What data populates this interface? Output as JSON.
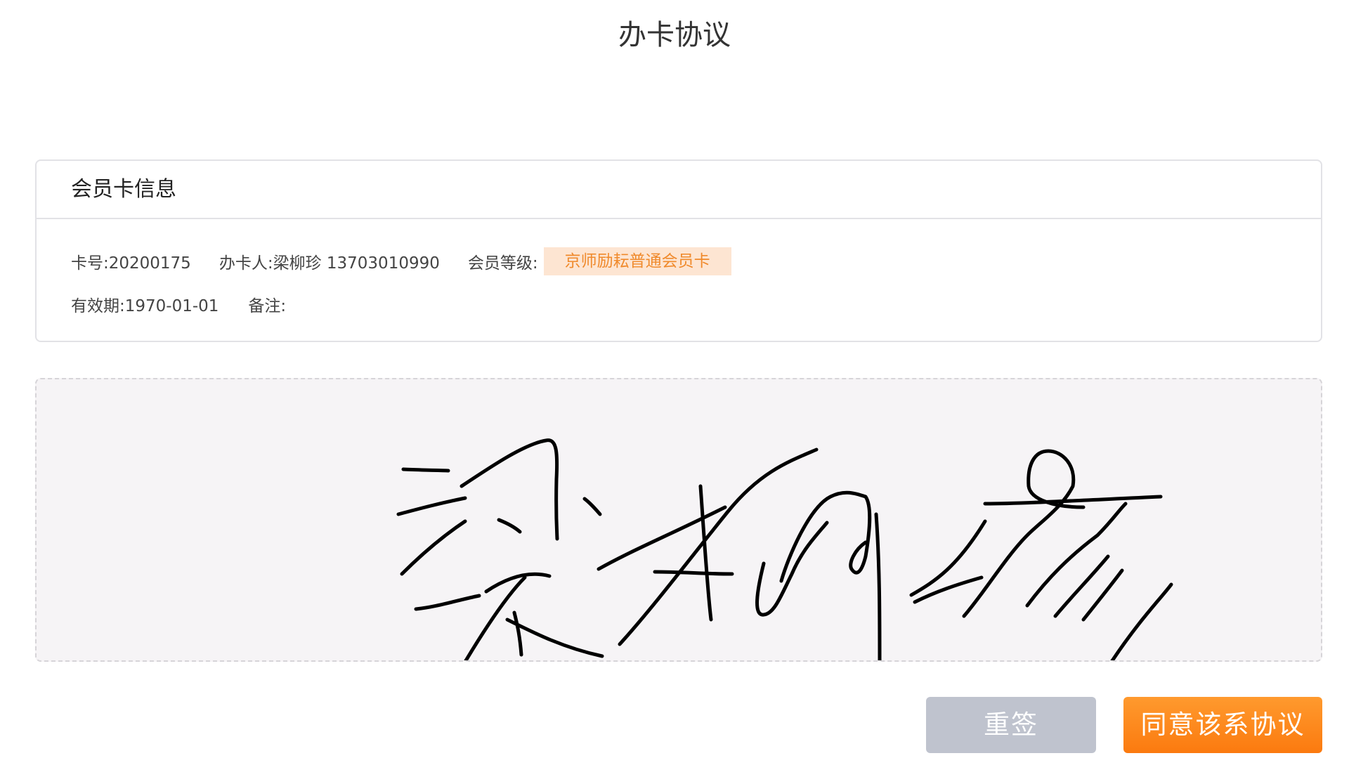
{
  "page": {
    "title": "办卡协议"
  },
  "card_info": {
    "header": "会员卡信息",
    "card_no": "卡号:20200175",
    "applicant": "办卡人:梁柳珍 13703010990",
    "level_label": "会员等级:",
    "level_value": "京师励耘普通会员卡",
    "expiry": "有效期:1970-01-01",
    "remark": "备注:"
  },
  "signature": {
    "signed_name": "梁柳珍"
  },
  "actions": {
    "resign_label": "重签",
    "agree_label": "同意该系协议"
  },
  "colors": {
    "accent": "#fb7a0f",
    "badge_bg": "#fde5d2",
    "badge_text": "#f08a2c",
    "resign_bg": "#bfc3ce",
    "signature_bg": "#f6f4f6"
  }
}
